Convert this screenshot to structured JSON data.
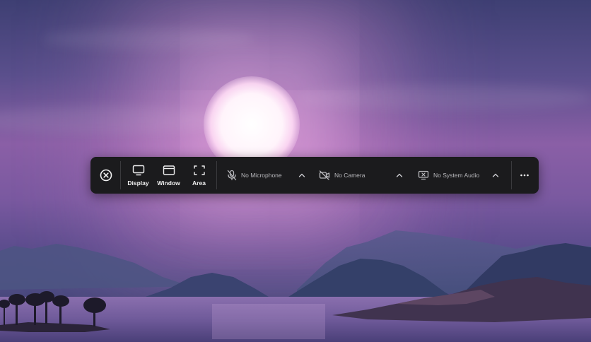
{
  "toolbar": {
    "close_icon": "close-circle-icon",
    "modes": [
      {
        "label": "Display",
        "icon": "monitor-icon"
      },
      {
        "label": "Window",
        "icon": "window-icon"
      },
      {
        "label": "Area",
        "icon": "area-select-icon"
      }
    ],
    "microphone": {
      "label": "No Microphone",
      "icon": "microphone-off-icon"
    },
    "camera": {
      "label": "No Camera",
      "icon": "camera-off-icon"
    },
    "system_audio": {
      "label": "No System Audio",
      "icon": "system-audio-off-icon"
    },
    "more_icon": "more-horizontal-icon"
  },
  "colors": {
    "toolbar_bg": "#1b1b1d",
    "text_primary": "#f0f0f0",
    "text_secondary": "#b8b8bc",
    "divider": "#3a3a3d"
  }
}
